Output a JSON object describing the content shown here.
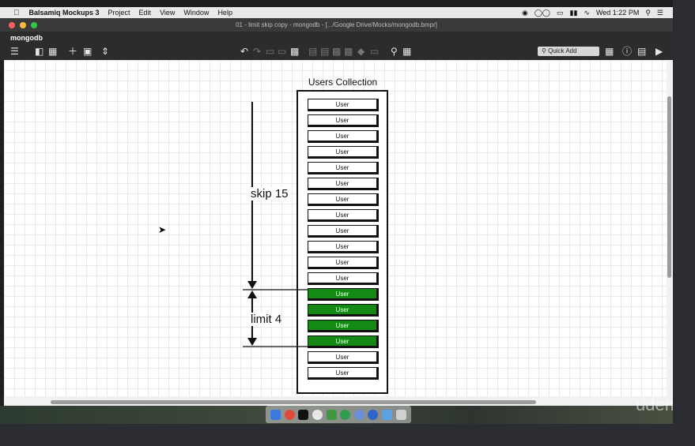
{
  "menubar": {
    "app_name": "Balsamiq Mockups 3",
    "items": [
      "Project",
      "Edit",
      "View",
      "Window",
      "Help"
    ],
    "clock": "Wed 1:22 PM"
  },
  "window": {
    "title": "01 - limit skip copy - mongodb - [.../Google Drive/Mocks/mongodb.bmpr]",
    "project_name": "mongodb"
  },
  "toolbar": {
    "quick_add_placeholder": "Quick Add"
  },
  "mockup": {
    "collection_title": "Users Collection",
    "row_label": "User",
    "skip_label": "skip 15",
    "limit_label": "limit 4",
    "rows": [
      {
        "label": "User",
        "highlighted": false
      },
      {
        "label": "User",
        "highlighted": false
      },
      {
        "label": "User",
        "highlighted": false
      },
      {
        "label": "User",
        "highlighted": false
      },
      {
        "label": "User",
        "highlighted": false
      },
      {
        "label": "User",
        "highlighted": false
      },
      {
        "label": "User",
        "highlighted": false
      },
      {
        "label": "User",
        "highlighted": false
      },
      {
        "label": "User",
        "highlighted": false
      },
      {
        "label": "User",
        "highlighted": false
      },
      {
        "label": "User",
        "highlighted": false
      },
      {
        "label": "User",
        "highlighted": false
      },
      {
        "label": "User",
        "highlighted": true
      },
      {
        "label": "User",
        "highlighted": true
      },
      {
        "label": "User",
        "highlighted": true
      },
      {
        "label": "User",
        "highlighted": true
      },
      {
        "label": "User",
        "highlighted": false
      },
      {
        "label": "User",
        "highlighted": false
      }
    ],
    "highlight_color": "#148a14"
  },
  "watermark": "udemy"
}
